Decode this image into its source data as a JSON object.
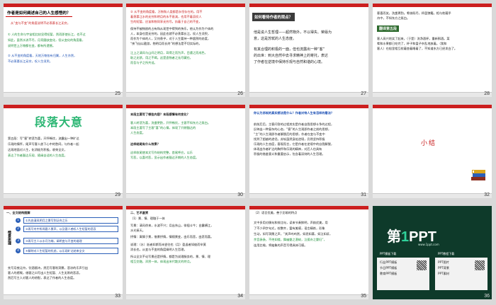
{
  "slides": [
    {
      "number": "25",
      "title": "作者是如何阐述自己的人生感悟的？",
      "lines_red": [
        "从“变与不变”的角度说明不必羡慕长江无穷。"
      ],
      "lines_green": [
        "① 人的生命与宇宙相比较显得短暂，然而即使长江，也不过",
        "如此，虽然水流不尽，月亮圆缺变化，但从变化的角度看，",
        "说明世上万物都在变，都有所遗憾。"
      ],
      "lines_blue": [
        "② 从不变的角度看，天地万物各有归属，人生亦然，",
        "不必羡慕长江无穷，叹人生须臾。"
      ]
    },
    {
      "number": "26",
      "lines_red": [
        "② 从不变的角度看，万物和人类都是永恒存在的。用不",
        "着羡慕江水的无穷和明月的永不衰减，也用不着哀叹人",
        "生的短暂，应该和物同享无穷尽。执着于自己的不变，"
      ],
      "lines_dark": [
        "保持不被物欲的占有和从现世中得到的快乐，他认为作为个体的",
        "人，本身也是无穷的，因此也就不必羡慕长江，叹人生须臾，",
        "而作为个体的人，又何羡乎，对于人生要持一种超然的态度，",
        "“挟飞仙以遨游，抱明月而长终”的想法是不切实际的，"
      ],
      "lines_green": [
        "江上之清风与山间之明月，耳得之而为声，目遇之而成色，",
        "取之无禁，用之不竭。这是造物者之无尽藏也，",
        "而吾与子之所共适。"
      ]
    },
    {
      "number": "27",
      "title": "如何看待作者的观点？",
      "body": [
        "他是说人生哲理——超然物外，不以得失、荣辱为",
        "意，这是苏轼的人生态度。",
        "有其合理的积极的一面，但也流露出一种“客”",
        "的出世：到大自然中去寻求精神上的寄托，表达",
        "了作者在逆境中保持乐观与自然和谐的心境。"
      ]
    },
    {
      "number": "28",
      "lines": [
        "客喜而笑，洗盏更酌。肴核既尽，杯盘狼籍。相与枕藉乎",
        "舟中，不知东方之既白。"
      ],
      "badge": "翻译第五段",
      "translation": [
        "客人高兴地笑了起来，（于是）洗净酒杯，重新斟酒。菜",
        "肴和水果都已吃完了，杯子和盘子杂乱地放着。（我和",
        "客人）在船里相互枕着垫着睡着了，不知道东方已经发白了。"
      ]
    },
    {
      "number": "29",
      "title": "段落大意",
      "body": [
        "第五段：写“客”转悲为喜，开怀畅饮，流露出一种旷达",
        "乐观的情怀，尾声写客人放下心中的愁闷，与作者一起",
        "达观地面对人生，化消极为积极，收束全文，",
        "表达了作者豁达乐观、随缘自适的人生态度。"
      ]
    },
    {
      "number": "30",
      "question": "本段主要写了哪些内容？本段感情有何变化？",
      "answer": [
        "客人转悲为喜，洗盏更酌，开怀畅饮，主客不知东方之既白。",
        "本段主要写了主客“喜”的心情，体现了开朗豁达的",
        "人生态度。"
      ],
      "question2": "这样结尾有什么效果？",
      "answer2": [
        "这样收尾使本文写作结构完整，首尾呼应，以乐",
        "写悲，以喜衬悲，显示出作者豁达开朗的人生态度。"
      ]
    },
    {
      "number": "31",
      "question": "你认为苏轼的真实想法是什么？作者对待人生有怎样的看法？",
      "body": [
        "前前后后，主客问答的过程其实是作者自我思想斗争的过程，",
        "反映出一种复杂的心态，“客”的人生观即作者之前的思想，",
        "“主”的人生观即作者解脱后的思想，作者在变与不变中",
        "找到了超越的途径。苏轼虽然身处逆境，仍然坚持积极",
        "乐观的人生态度，客观而言，它是作者在逆境中的自我解脱，",
        "体现出作者旷达的胸怀和乐观的精神，对后人也具有",
        "积极的借鉴意义和重要启示，包含着深刻的人生哲理。"
      ]
    },
    {
      "number": "32",
      "title": "小结"
    },
    {
      "number": "33",
      "header": "一、全文结构图解",
      "side": "情景思理",
      "boxes": [
        "①先由清风明月之景写到泛舟之乐",
        "②再写舟中所闻客人箫声，以及客人感叹人生短暂的悲哀",
        "③再写主人以水月为喻，阐明变与不变的道理",
        "④解除对人生短暂的忧虑，以乐观旷达结束全文"
      ],
      "footer": [
        "先写月夜泛舟，饮酒赋诗，然后写客吹洞箫，悲凉的乐声引出",
        "客人的感慨，借客之口写出人生短暂、人生无常的悲哀，",
        "然后写主人对客人的劝慰，表达了作者的人生态度。"
      ]
    },
    {
      "number": "34",
      "header": "二、艺术鉴赏",
      "subheader": "（1）景、情、理融于一体",
      "lines": [
        "写景：清风徐来，水波不兴；月出东山，徘徊斗牛；白露横江，",
        "水光接天。",
        "抒情：寓情于景，借景抒情，情随景变，由乐而悲，由悲而喜。",
        "说理：（水）逝者如斯而未尝往也（月）盈虚者如彼而卒莫",
        "消长也，从变与不变的角度阐明人生哲理，",
        "所以全文不论写景还是抒情，都是为说理服务的，景、情、理",
        "相互交融，浑然一体，体现出宋代散文的特点。"
      ]
    },
    {
      "number": "35",
      "header": "（2）语言优美，善于比喻的特点",
      "lines": [
        "文中多用对偶句和排比句，读来节奏鲜明，声韵优美，用",
        "了不少四字句式，较整齐，富有美感，语言精炼，形象",
        "生动，如写洞箫之声，“其声呜呜然，如怨如慕，如泣如诉，",
        "余音袅袅，不绝如缕，舞幽壑之潜蛟，泣孤舟之嫠妇”，",
        "连用比喻，将抽象的声音写得具体可感。"
      ]
    },
    {
      "number": "36",
      "logo_prefix": "第",
      "logo_one": "1",
      "logo_suffix": "PPT",
      "logo_url": "www.1ppt.com",
      "panel_left_title": "PPT模板下载",
      "panel_right_title": "PPT教程下载",
      "panel_left_lines": [
        "行业PPT模板",
        "节日PPT模板",
        "教育PPT模板"
      ],
      "panel_right_lines": [
        "PPT图片",
        "PPT背景",
        "PPT素材"
      ]
    }
  ],
  "colors": {
    "accent_red": "#cc1f1f",
    "selection": "#f0a500",
    "green_text": "#1f8f3a",
    "blue_text": "#1b4fb5"
  }
}
